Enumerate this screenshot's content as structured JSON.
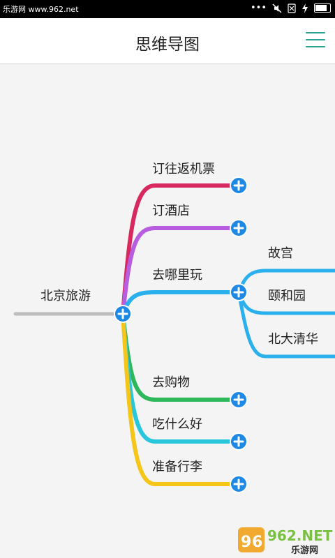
{
  "status_bar": {
    "source_label": "乐游网 www.962.net",
    "icons": [
      "dots-icon",
      "mute-icon",
      "sim-icon",
      "charging-icon",
      "battery-icon"
    ]
  },
  "header": {
    "title": "思维导图",
    "menu_icon": "hamburger-menu-icon"
  },
  "mindmap": {
    "root": "北京旅游",
    "branches": [
      {
        "label": "订往返机票",
        "color": "#d7285f"
      },
      {
        "label": "订酒店",
        "color": "#b85ce0"
      },
      {
        "label": "去哪里玩",
        "color": "#2ab0ec",
        "children": [
          "故宫",
          "颐和园",
          "北大清华"
        ]
      },
      {
        "label": "去购物",
        "color": "#2eb85c"
      },
      {
        "label": "吃什么好",
        "color": "#29c6dc"
      },
      {
        "label": "准备行李",
        "color": "#f5c518"
      }
    ]
  },
  "watermark": {
    "brand": "962.NET",
    "sub": "乐游网"
  }
}
